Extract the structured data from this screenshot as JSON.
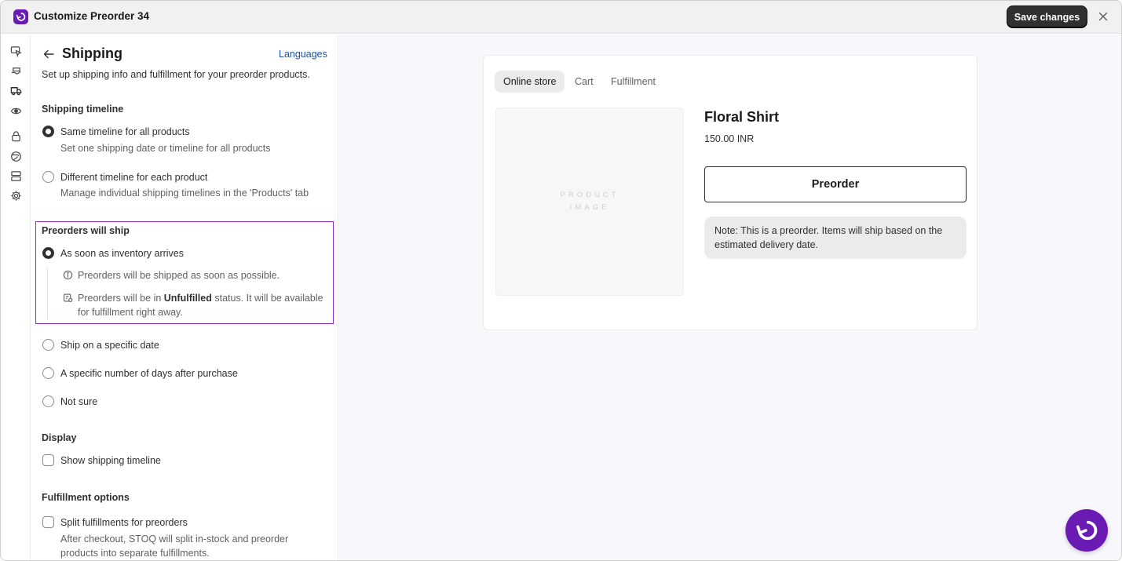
{
  "window": {
    "title": "Customize Preorder 34",
    "save_label": "Save changes"
  },
  "rail": {
    "icons": [
      "cursor-icon",
      "hand-money-icon",
      "truck-icon",
      "eye-icon",
      "lock-icon",
      "globe-icon",
      "layout-icon",
      "gear-icon"
    ]
  },
  "panel": {
    "title": "Shipping",
    "languages_link": "Languages",
    "subtitle": "Set up shipping info and fulfillment for your preorder products.",
    "shipping_timeline": {
      "heading": "Shipping timeline",
      "options": [
        {
          "label": "Same timeline for all products",
          "help": "Set one shipping date or timeline for all products",
          "selected": true
        },
        {
          "label": "Different timeline for each product",
          "help": "Manage individual shipping timelines in the 'Products' tab",
          "selected": false
        }
      ]
    },
    "preorders_ship": {
      "heading": "Preorders will ship",
      "options": [
        {
          "label": "As soon as inventory arrives",
          "selected": true
        },
        {
          "label": "Ship on a specific date",
          "selected": false
        },
        {
          "label": "A specific number of days after purchase",
          "selected": false
        },
        {
          "label": "Not sure",
          "selected": false
        }
      ],
      "info_1": "Preorders will be shipped as soon as possible.",
      "info_2_prefix": "Preorders will be in ",
      "info_2_bold": "Unfulfilled",
      "info_2_suffix": " status. It will be available",
      "info_2_line2": "for fulfillment right away."
    },
    "display": {
      "heading": "Display",
      "checkbox_label": "Show shipping timeline",
      "checked": false
    },
    "fulfillment": {
      "heading": "Fulfillment options",
      "checkbox_label": "Split fulfillments for preorders",
      "checked": false,
      "help_line1": "After checkout, STOQ will split in-stock and preorder",
      "help_line2": "products into separate fulfillments."
    }
  },
  "preview": {
    "tabs": [
      {
        "label": "Online store",
        "active": true
      },
      {
        "label": "Cart",
        "active": false
      },
      {
        "label": "Fulfillment",
        "active": false
      }
    ],
    "image_placeholder": "PRODUCT IMAGE",
    "product_name": "Floral Shirt",
    "price": "150.00 INR",
    "button_label": "Preorder",
    "note": "Note: This is a preorder. Items will ship based on the estimated delivery date."
  },
  "colors": {
    "brand": "#6a1bb3",
    "highlight_border": "#8a2fc9",
    "link": "#1f5199",
    "primary_button": "#303030"
  }
}
